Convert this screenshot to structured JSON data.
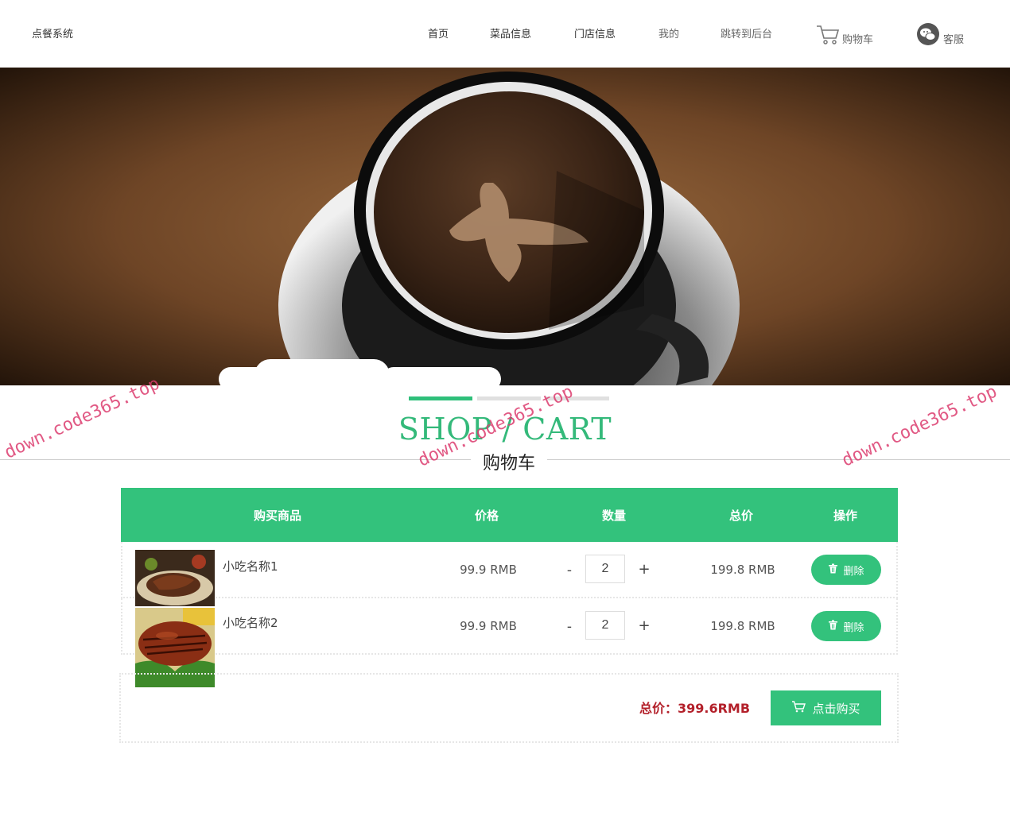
{
  "header": {
    "logo": "点餐系统",
    "nav": [
      "首页",
      "菜品信息",
      "门店信息",
      "我的",
      "跳转到后台"
    ],
    "cart_label": "购物车",
    "service_label": "客服"
  },
  "section": {
    "title_en": "SHOP / CART",
    "title_cn": "购物车"
  },
  "table": {
    "headers": [
      "购买商品",
      "价格",
      "数量",
      "总价",
      "操作"
    ],
    "rows": [
      {
        "name": "小吃名称1",
        "price": "99.9 RMB",
        "qty": "2",
        "subtotal": "199.8 RMB",
        "action": "删除"
      },
      {
        "name": "小吃名称2",
        "price": "99.9 RMB",
        "qty": "2",
        "subtotal": "199.8 RMB",
        "action": "删除"
      }
    ],
    "minus": "-",
    "plus": "+"
  },
  "summary": {
    "total": "总价：399.6RMB",
    "buy_label": "点击购买"
  },
  "watermark": "down.code365.top",
  "colors": {
    "accent": "#33c27c",
    "total": "#b3202a",
    "watermark": "#dc3c6e"
  }
}
